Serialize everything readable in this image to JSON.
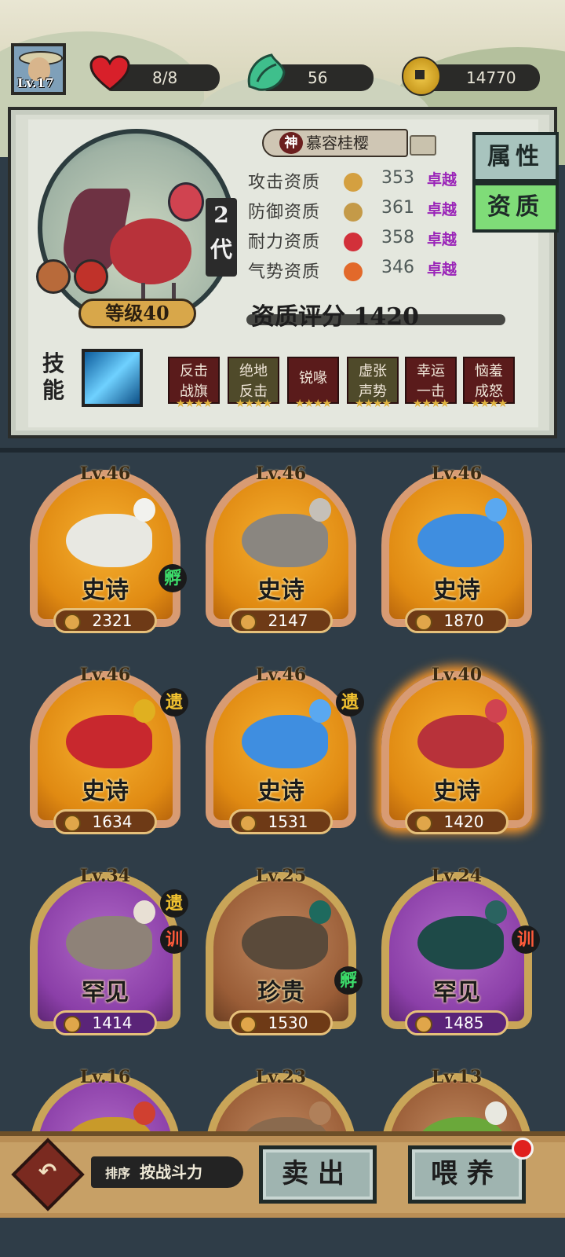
{
  "status": {
    "level": "Lv.17",
    "hearts": "8/8",
    "energy": "56",
    "coins": "14770"
  },
  "detail": {
    "tag": "神",
    "name": "慕容桂樱",
    "generation": "2代",
    "level": "等级40",
    "attributes": [
      {
        "label": "攻击资质",
        "value": "353",
        "grade": "卓越"
      },
      {
        "label": "防御资质",
        "value": "361",
        "grade": "卓越"
      },
      {
        "label": "耐力资质",
        "value": "358",
        "grade": "卓越"
      },
      {
        "label": "气势资质",
        "value": "346",
        "grade": "卓越"
      }
    ],
    "score": "资质评分 1420",
    "tabs": {
      "attributes": "属性",
      "aptitude": "资质"
    },
    "skill_label": "技能",
    "skills": [
      "反击\n战旗",
      "绝地\n反击",
      "锐喙",
      "虚张\n声势",
      "幸运\n一击",
      "恼羞\n成怒"
    ]
  },
  "cards": [
    {
      "lv": "Lv.46",
      "rarity": "史诗",
      "power": "2321",
      "tag": "孵",
      "tag2": ""
    },
    {
      "lv": "Lv.46",
      "rarity": "史诗",
      "power": "2147",
      "tag": "",
      "tag2": ""
    },
    {
      "lv": "Lv.46",
      "rarity": "史诗",
      "power": "1870",
      "tag": "",
      "tag2": ""
    },
    {
      "lv": "Lv.46",
      "rarity": "史诗",
      "power": "1634",
      "tag": "遗",
      "tag2": ""
    },
    {
      "lv": "Lv.46",
      "rarity": "史诗",
      "power": "1531",
      "tag": "遗",
      "tag2": ""
    },
    {
      "lv": "Lv.40",
      "rarity": "史诗",
      "power": "1420",
      "tag": "",
      "tag2": ""
    },
    {
      "lv": "Lv.34",
      "rarity": "罕见",
      "power": "1414",
      "tag": "遗",
      "tag2": "训"
    },
    {
      "lv": "Lv.25",
      "rarity": "珍贵",
      "power": "1530",
      "tag": "孵",
      "tag2": ""
    },
    {
      "lv": "Lv.24",
      "rarity": "罕见",
      "power": "1485",
      "tag": "训",
      "tag2": ""
    },
    {
      "lv": "Lv.16"
    },
    {
      "lv": "Lv.23"
    },
    {
      "lv": "Lv.13"
    }
  ],
  "bottom": {
    "sort_prefix": "排序",
    "sort_value": "按战斗力",
    "sell": "卖出",
    "feed": "喂养"
  },
  "colors": {
    "epic": "#e08a12",
    "rare": "#8b3fa8",
    "precious": "#9a5d37",
    "grade": "#9a24b8"
  }
}
